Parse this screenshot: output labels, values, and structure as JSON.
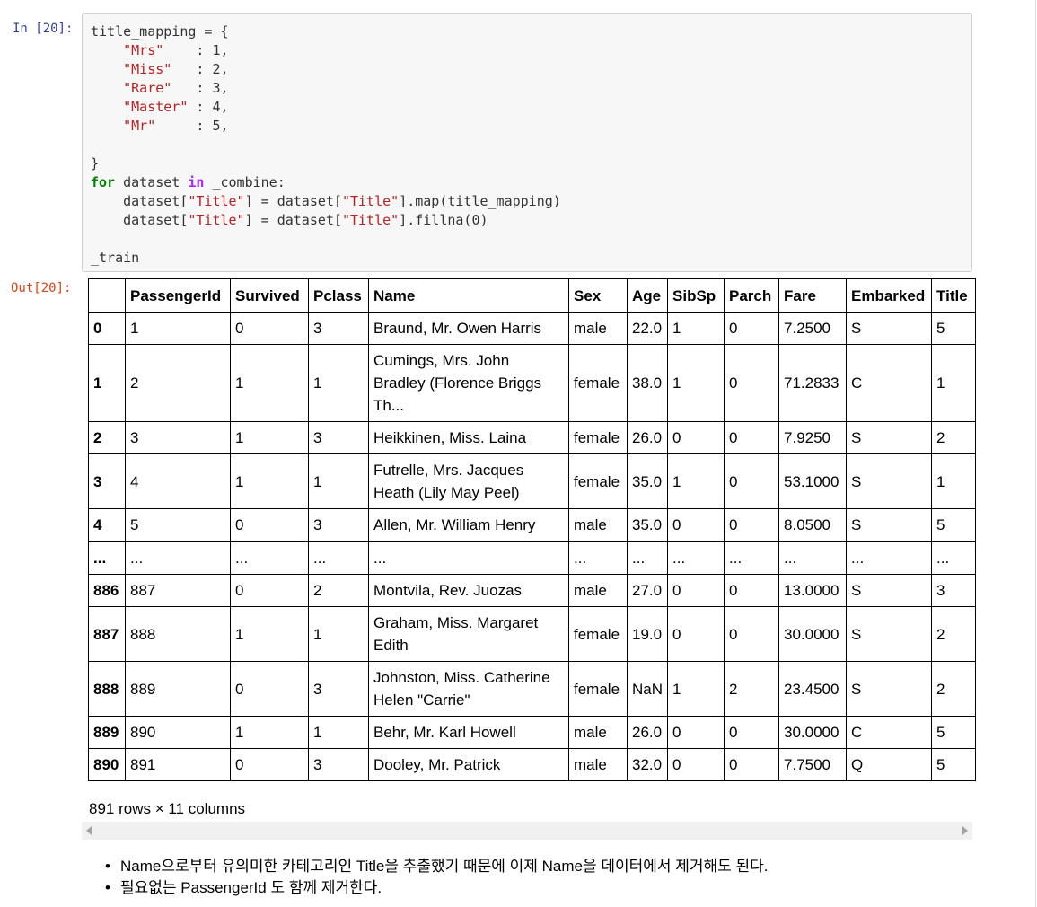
{
  "input_prompt": "In [20]:",
  "output_prompt": "Out[20]:",
  "code": {
    "lines": [
      [
        {
          "t": "plain",
          "v": "title_mapping = {"
        }
      ],
      [
        {
          "t": "plain",
          "v": "    "
        },
        {
          "t": "str",
          "v": "\"Mrs\""
        },
        {
          "t": "plain",
          "v": "    : 1,"
        }
      ],
      [
        {
          "t": "plain",
          "v": "    "
        },
        {
          "t": "str",
          "v": "\"Miss\""
        },
        {
          "t": "plain",
          "v": "   : 2,"
        }
      ],
      [
        {
          "t": "plain",
          "v": "    "
        },
        {
          "t": "str",
          "v": "\"Rare\""
        },
        {
          "t": "plain",
          "v": "   : 3,"
        }
      ],
      [
        {
          "t": "plain",
          "v": "    "
        },
        {
          "t": "str",
          "v": "\"Master\""
        },
        {
          "t": "plain",
          "v": " : 4,"
        }
      ],
      [
        {
          "t": "plain",
          "v": "    "
        },
        {
          "t": "str",
          "v": "\"Mr\""
        },
        {
          "t": "plain",
          "v": "     : 5,"
        }
      ],
      [
        {
          "t": "plain",
          "v": ""
        }
      ],
      [
        {
          "t": "plain",
          "v": "}"
        }
      ],
      [
        {
          "t": "kw",
          "v": "for"
        },
        {
          "t": "plain",
          "v": " dataset "
        },
        {
          "t": "op",
          "v": "in"
        },
        {
          "t": "plain",
          "v": " _combine:"
        }
      ],
      [
        {
          "t": "plain",
          "v": "    dataset["
        },
        {
          "t": "str",
          "v": "\"Title\""
        },
        {
          "t": "plain",
          "v": "] = dataset["
        },
        {
          "t": "str",
          "v": "\"Title\""
        },
        {
          "t": "plain",
          "v": "].map(title_mapping)"
        }
      ],
      [
        {
          "t": "plain",
          "v": "    dataset["
        },
        {
          "t": "str",
          "v": "\"Title\""
        },
        {
          "t": "plain",
          "v": "] = dataset["
        },
        {
          "t": "str",
          "v": "\"Title\""
        },
        {
          "t": "plain",
          "v": "].fillna(0)"
        }
      ],
      [
        {
          "t": "plain",
          "v": ""
        }
      ],
      [
        {
          "t": "plain",
          "v": "_train"
        }
      ]
    ]
  },
  "table": {
    "columns": [
      "",
      "PassengerId",
      "Survived",
      "Pclass",
      "Name",
      "Sex",
      "Age",
      "SibSp",
      "Parch",
      "Fare",
      "Embarked",
      "Title"
    ],
    "rows": [
      {
        "index": "0",
        "cells": [
          "1",
          "0",
          "3",
          "Braund, Mr. Owen Harris",
          "male",
          "22.0",
          "1",
          "0",
          "7.2500",
          "S",
          "5"
        ]
      },
      {
        "index": "1",
        "cells": [
          "2",
          "1",
          "1",
          "Cumings, Mrs. John Bradley (Florence Briggs Th...",
          "female",
          "38.0",
          "1",
          "0",
          "71.2833",
          "C",
          "1"
        ]
      },
      {
        "index": "2",
        "cells": [
          "3",
          "1",
          "3",
          "Heikkinen, Miss. Laina",
          "female",
          "26.0",
          "0",
          "0",
          "7.9250",
          "S",
          "2"
        ]
      },
      {
        "index": "3",
        "cells": [
          "4",
          "1",
          "1",
          "Futrelle, Mrs. Jacques Heath (Lily May Peel)",
          "female",
          "35.0",
          "1",
          "0",
          "53.1000",
          "S",
          "1"
        ]
      },
      {
        "index": "4",
        "cells": [
          "5",
          "0",
          "3",
          "Allen, Mr. William Henry",
          "male",
          "35.0",
          "0",
          "0",
          "8.0500",
          "S",
          "5"
        ]
      },
      {
        "index": "...",
        "cells": [
          "...",
          "...",
          "...",
          "...",
          "...",
          "...",
          "...",
          "...",
          "...",
          "...",
          "..."
        ]
      },
      {
        "index": "886",
        "cells": [
          "887",
          "0",
          "2",
          "Montvila, Rev. Juozas",
          "male",
          "27.0",
          "0",
          "0",
          "13.0000",
          "S",
          "3"
        ]
      },
      {
        "index": "887",
        "cells": [
          "888",
          "1",
          "1",
          "Graham, Miss. Margaret Edith",
          "female",
          "19.0",
          "0",
          "0",
          "30.0000",
          "S",
          "2"
        ]
      },
      {
        "index": "888",
        "cells": [
          "889",
          "0",
          "3",
          "Johnston, Miss. Catherine Helen \"Carrie\"",
          "female",
          "NaN",
          "1",
          "2",
          "23.4500",
          "S",
          "2"
        ]
      },
      {
        "index": "889",
        "cells": [
          "890",
          "1",
          "1",
          "Behr, Mr. Karl Howell",
          "male",
          "26.0",
          "0",
          "0",
          "30.0000",
          "C",
          "5"
        ]
      },
      {
        "index": "890",
        "cells": [
          "891",
          "0",
          "3",
          "Dooley, Mr. Patrick",
          "male",
          "32.0",
          "0",
          "0",
          "7.7500",
          "Q",
          "5"
        ]
      }
    ]
  },
  "rows_info": "891 rows × 11 columns",
  "notes": [
    "Name으로부터 유의미한 카테고리인 Title을 추출했기 때문에 이제 Name을 데이터에서 제거해도 된다.",
    "필요없는 PassengerId 도 함께 제거한다."
  ]
}
